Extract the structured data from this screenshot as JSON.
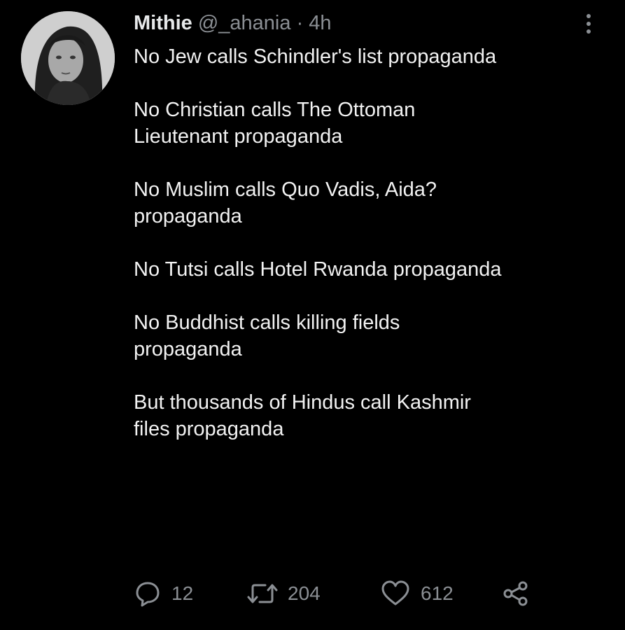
{
  "tweet": {
    "author": {
      "name": "Mithie",
      "handle": "@_ahania",
      "separator": "·",
      "time": "4h"
    },
    "paragraphs": [
      "No Jew calls Schindler's list propaganda",
      "No Christian calls The Ottoman\nLieutenant propaganda",
      "No Muslim calls Quo Vadis, Aida?\npropaganda",
      "No Tutsi calls Hotel Rwanda propaganda",
      "No Buddhist calls killing fields\npropaganda",
      "But thousands of Hindus call Kashmir\nfiles propaganda"
    ],
    "actions": {
      "replies": "12",
      "retweets": "204",
      "likes": "612"
    },
    "icons": {
      "more": "vertical-ellipsis-icon",
      "reply": "speech-bubble-icon",
      "retweet": "retweet-arrows-icon",
      "like": "heart-icon",
      "share": "share-nodes-icon"
    }
  }
}
